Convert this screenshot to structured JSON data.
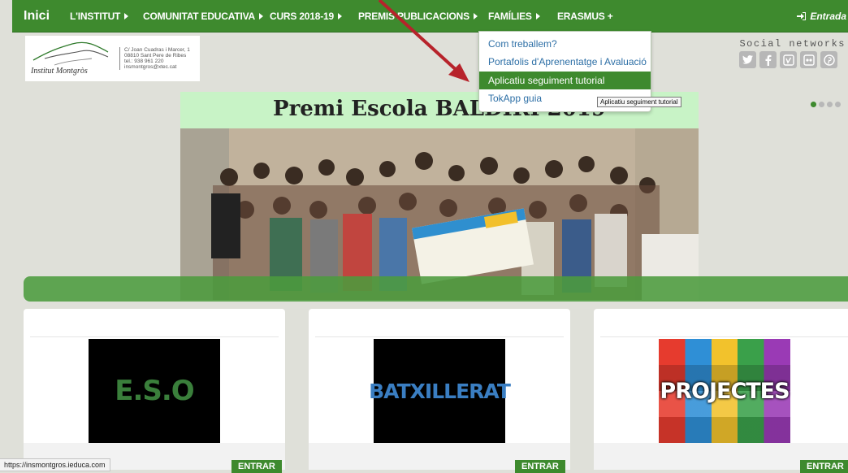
{
  "nav": {
    "home": "Inici",
    "items": [
      {
        "label": "L'INSTITUT"
      },
      {
        "label": "COMUNITAT EDUCATIVA"
      },
      {
        "label": "CURS 2018-19"
      },
      {
        "label": "PREMIS PUBLICACIONS"
      },
      {
        "label": "FAMÍLIES"
      },
      {
        "label": "ERASMUS +"
      }
    ],
    "login": "Entrada"
  },
  "logo": {
    "name": "Institut Montgròs",
    "address": [
      "C/ Joan Cuadras i Marcer, 1",
      "08810 Sant Pere de Ribes",
      "tel.: 938 961 220",
      "insmontgros@xtec.cat"
    ]
  },
  "social": {
    "title": "Social networks",
    "icons": [
      "twitter-icon",
      "facebook-icon",
      "vimeo-icon",
      "flickr-icon",
      "pinterest-icon"
    ]
  },
  "banner": {
    "title": "Premi Escola BALDIRI 2019"
  },
  "dropdown": {
    "items": [
      {
        "label": "Com treballem?"
      },
      {
        "label": "Portafolis d'Aprenentatge i Avaluació"
      },
      {
        "label": "Aplicatiu seguiment tutorial"
      },
      {
        "label": "TokApp guia"
      }
    ],
    "tooltip": "Aplicatiu seguiment tutorial"
  },
  "cards": [
    {
      "title": "E.S.O",
      "color": "#3a7f3b",
      "button": "ENTRAR"
    },
    {
      "title": "BATXILLERAT",
      "color": "#3a7ec2",
      "button": "ENTRAR"
    },
    {
      "title": "PROJECTES",
      "color": "#ffffff",
      "button": "ENTRAR"
    }
  ],
  "status_url": "https://insmontgros.ieduca.com",
  "colors": {
    "accent": "#3e8a2e",
    "link": "#2d6fa6",
    "annotation": "#c0232b"
  }
}
